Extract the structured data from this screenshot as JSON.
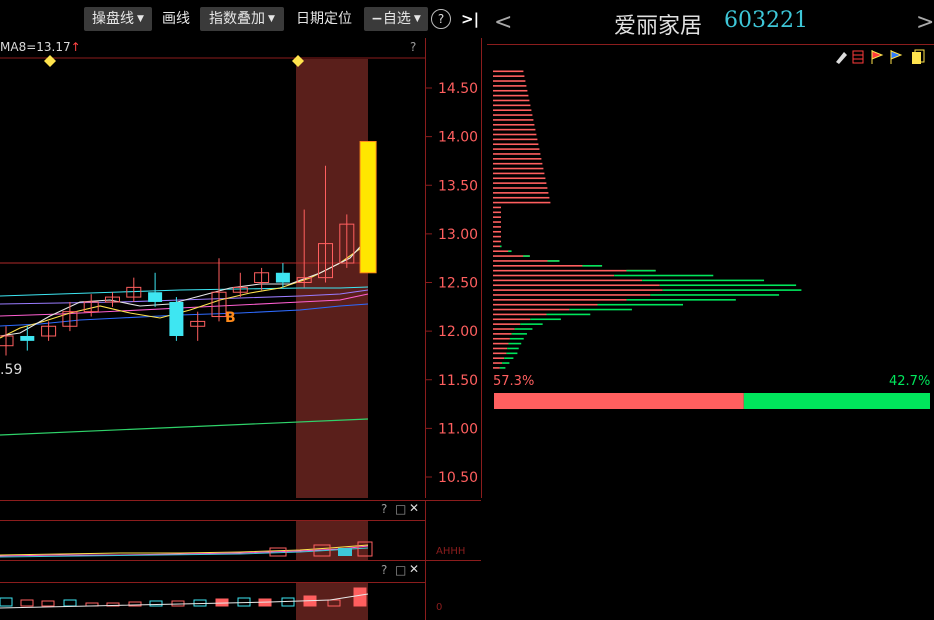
{
  "toolbar": {
    "buttons": [
      {
        "label": "操盘线",
        "dropdown": true
      },
      {
        "label": "画线",
        "dropdown": false
      },
      {
        "label": "指数叠加",
        "dropdown": true
      },
      {
        "label": "日期定位",
        "dropdown": false
      },
      {
        "label": "自选",
        "dropdown": true
      }
    ],
    "help": "?"
  },
  "main_chart": {
    "ma_label": "MA8=13.17",
    "help": "?",
    "low_label": ".59",
    "buy_marker": "B",
    "y_ticks": [
      "14.50",
      "14.00",
      "13.50",
      "13.00",
      "12.50",
      "12.00",
      "11.50",
      "11.00",
      "10.50"
    ],
    "candles": [
      {
        "o": 11.85,
        "c": 11.95,
        "h": 12.05,
        "l": 11.75
      },
      {
        "o": 11.95,
        "c": 11.9,
        "h": 12.05,
        "l": 11.8
      },
      {
        "o": 11.95,
        "c": 12.05,
        "h": 12.1,
        "l": 11.9
      },
      {
        "o": 12.05,
        "c": 12.2,
        "h": 12.3,
        "l": 12.0
      },
      {
        "o": 12.2,
        "c": 12.3,
        "h": 12.38,
        "l": 12.15
      },
      {
        "o": 12.3,
        "c": 12.35,
        "h": 12.4,
        "l": 12.25
      },
      {
        "o": 12.35,
        "c": 12.45,
        "h": 12.55,
        "l": 12.3
      },
      {
        "o": 12.4,
        "c": 12.3,
        "h": 12.6,
        "l": 12.25
      },
      {
        "o": 12.3,
        "c": 11.95,
        "h": 12.35,
        "l": 11.9
      },
      {
        "o": 12.05,
        "c": 12.1,
        "h": 12.2,
        "l": 11.9
      },
      {
        "o": 12.15,
        "c": 12.4,
        "h": 12.75,
        "l": 12.1
      },
      {
        "o": 12.4,
        "c": 12.45,
        "h": 12.6,
        "l": 12.35
      },
      {
        "o": 12.5,
        "c": 12.6,
        "h": 12.65,
        "l": 12.42
      },
      {
        "o": 12.6,
        "c": 12.5,
        "h": 12.7,
        "l": 12.45
      },
      {
        "o": 12.5,
        "c": 12.55,
        "h": 13.25,
        "l": 12.45
      },
      {
        "o": 12.55,
        "c": 12.9,
        "h": 13.7,
        "l": 12.5
      },
      {
        "o": 12.7,
        "c": 13.1,
        "h": 13.2,
        "l": 12.65
      },
      {
        "o": 12.6,
        "c": 13.95,
        "h": 13.95,
        "l": 12.6
      }
    ]
  },
  "sub_chart_1": {
    "help": "?",
    "restore": "□",
    "close": "✕"
  },
  "sub_chart_2": {
    "help": "?",
    "restore": "□",
    "close": "✕"
  },
  "right_panel": {
    "stock_name": "爱丽家居",
    "stock_code": "603221",
    "profit_pct": "57.3%",
    "loss_pct": "42.7%",
    "profit_ratio": 0.573,
    "colors": {
      "profit": "#ff5f5f",
      "loss": "#00e65c",
      "highlight": "#ffe600",
      "accent": "#3ec7d8"
    }
  }
}
